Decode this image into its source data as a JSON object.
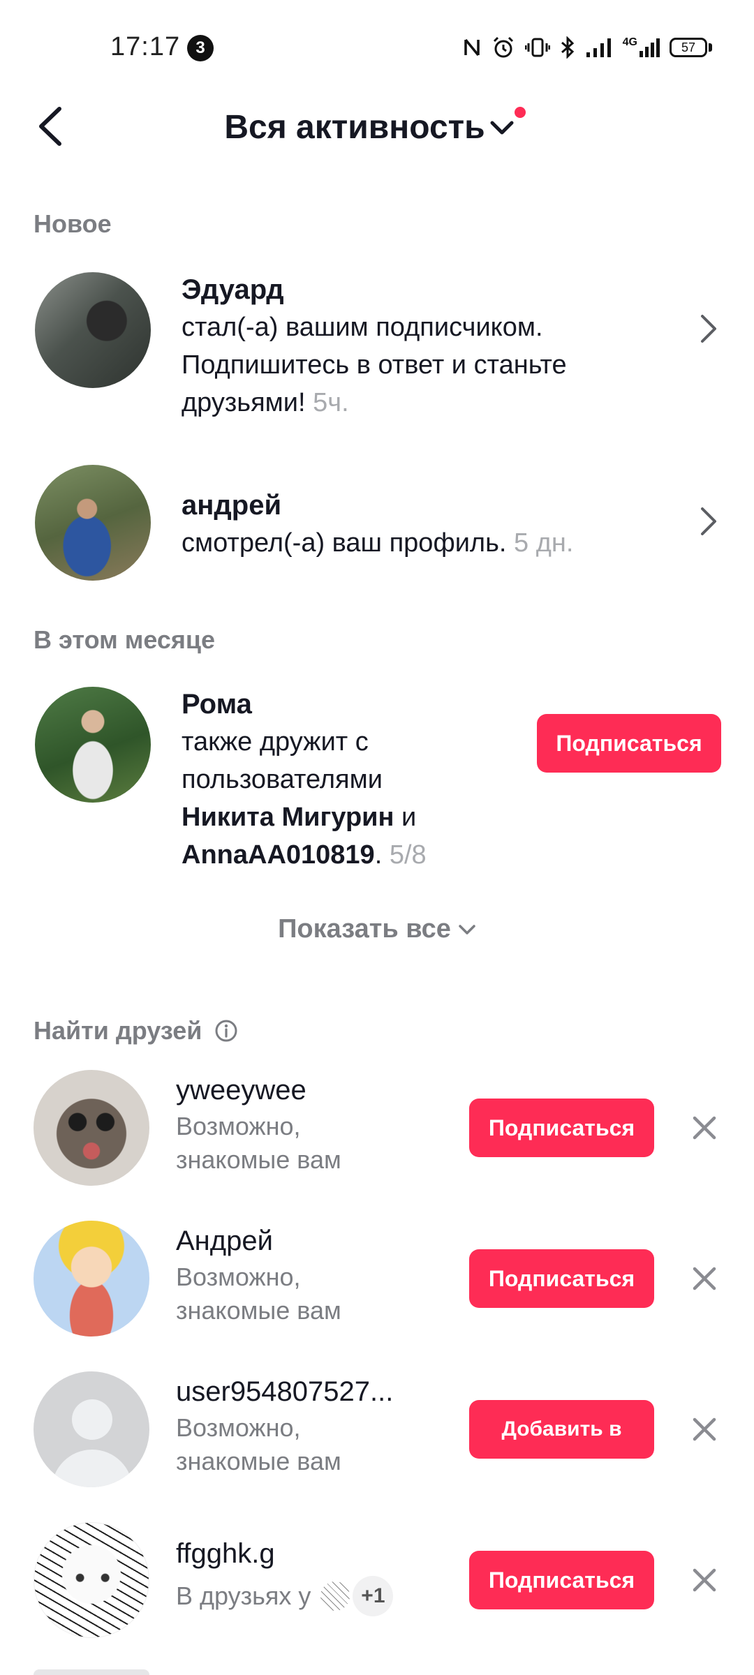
{
  "status_bar": {
    "time": "17:17",
    "notification_count": "3",
    "network": "4G",
    "battery": "57"
  },
  "header": {
    "title": "Вся активность"
  },
  "sections": {
    "new": "Новое",
    "this_month": "В этом месяце",
    "find_friends": "Найти друзей"
  },
  "new_items": [
    {
      "name": "Эдуард",
      "line1": "стал(-а) вашим подписчиком.",
      "line2": "Подпишитесь в ответ и станьте",
      "line3": "друзьями!",
      "time": "5ч."
    },
    {
      "name": "андрей",
      "line1": "смотрел(-а) ваш профиль.",
      "time": "5 дн."
    }
  ],
  "month_item": {
    "name": "Рома",
    "line1": "также дружит с",
    "line2": "пользователями",
    "friend1": "Никита Мигурин",
    "conj": "и",
    "friend2": "AnnaAA010819",
    "time": "5/8",
    "button": "Подписаться"
  },
  "show_all": "Показать все",
  "suggestions": [
    {
      "name": "yweeywee",
      "sub1": "Возможно,",
      "sub2": "знакомые вам",
      "button": "Подписаться"
    },
    {
      "name": "Андрей",
      "sub1": "Возможно,",
      "sub2": "знакомые вам",
      "button": "Подписаться"
    },
    {
      "name": "user954807527...",
      "sub1": "Возможно,",
      "sub2": "знакомые вам",
      "button": "Добавить в"
    },
    {
      "name": "ffgghk.g",
      "sub1": "В друзьях у",
      "extra": "+1",
      "button": "Подписаться"
    }
  ],
  "colors": {
    "accent": "#fe2c55",
    "muted_text": "#7b7d82",
    "time_text": "#a8aaae"
  }
}
